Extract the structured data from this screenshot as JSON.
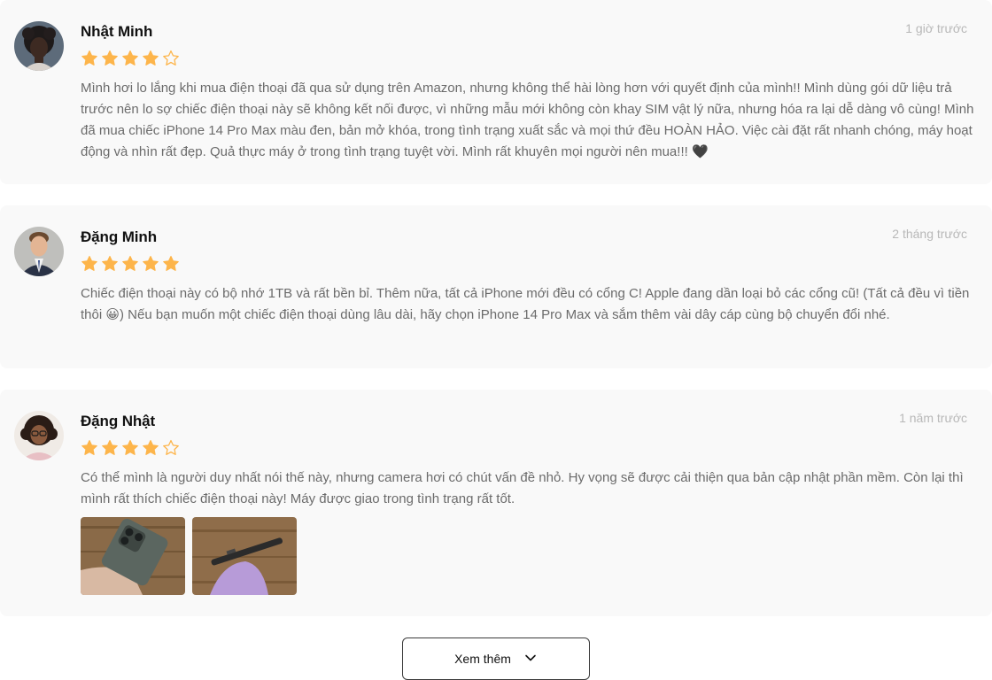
{
  "reviews": [
    {
      "name": "Nhật Minh",
      "time": "1 giờ trước",
      "rating": 4,
      "text": "Mình hơi lo lắng khi mua điện thoại đã qua sử dụng trên Amazon, nhưng không thể hài lòng hơn với quyết định của mình!! Mình dùng gói dữ liệu trả trước nên lo sợ chiếc điện thoại này sẽ không kết nối được, vì những mẫu mới không còn khay SIM vật lý nữa, nhưng hóa ra lại dễ dàng vô cùng! Mình đã mua chiếc iPhone 14 Pro Max màu đen, bản mở khóa, trong tình trạng xuất sắc và mọi thứ đều HOÀN HẢO. Việc cài đặt rất nhanh chóng, máy hoạt động và nhìn rất đẹp. Quả thực máy ở trong tình trạng tuyệt vời. Mình rất khuyên mọi người nên mua!!! 🖤",
      "avatar_icon": "avatar-woman-curly-hair"
    },
    {
      "name": "Đặng Minh",
      "time": "2 tháng trước",
      "rating": 5,
      "text": "Chiếc điện thoại này có bộ nhớ 1TB và rất bền bỉ. Thêm nữa, tất cả iPhone mới đều có cổng C! Apple đang dần loại bỏ các cổng cũ! (Tất cả đều vì tiền thôi 😀) Nếu bạn muốn một chiếc điện thoại dùng lâu dài, hãy chọn iPhone 14 Pro Max và sắm thêm vài dây cáp cùng bộ chuyển đổi nhé.",
      "avatar_icon": "avatar-man-suit"
    },
    {
      "name": "Đặng Nhật",
      "time": "1 năm trước",
      "rating": 4,
      "text": "Có thể mình là người duy nhất nói thế này, nhưng camera hơi có chút vấn đề nhỏ. Hy vọng sẽ được cải thiện qua bản cập nhật phần mềm. Còn lại thì mình rất thích chiếc điện thoại này! Máy được giao trong tình trạng rất tốt.",
      "avatar_icon": "avatar-woman-glasses",
      "photos": [
        "phone-back-in-hand",
        "phone-side-in-hand"
      ]
    }
  ],
  "more_button": {
    "label": "Xem thêm",
    "icon": "chevron-down-icon"
  },
  "colors": {
    "star": "#fdb54b",
    "card_bg": "#f9f9f9",
    "text": "#6b6b6b",
    "muted": "#b8b8b8"
  }
}
